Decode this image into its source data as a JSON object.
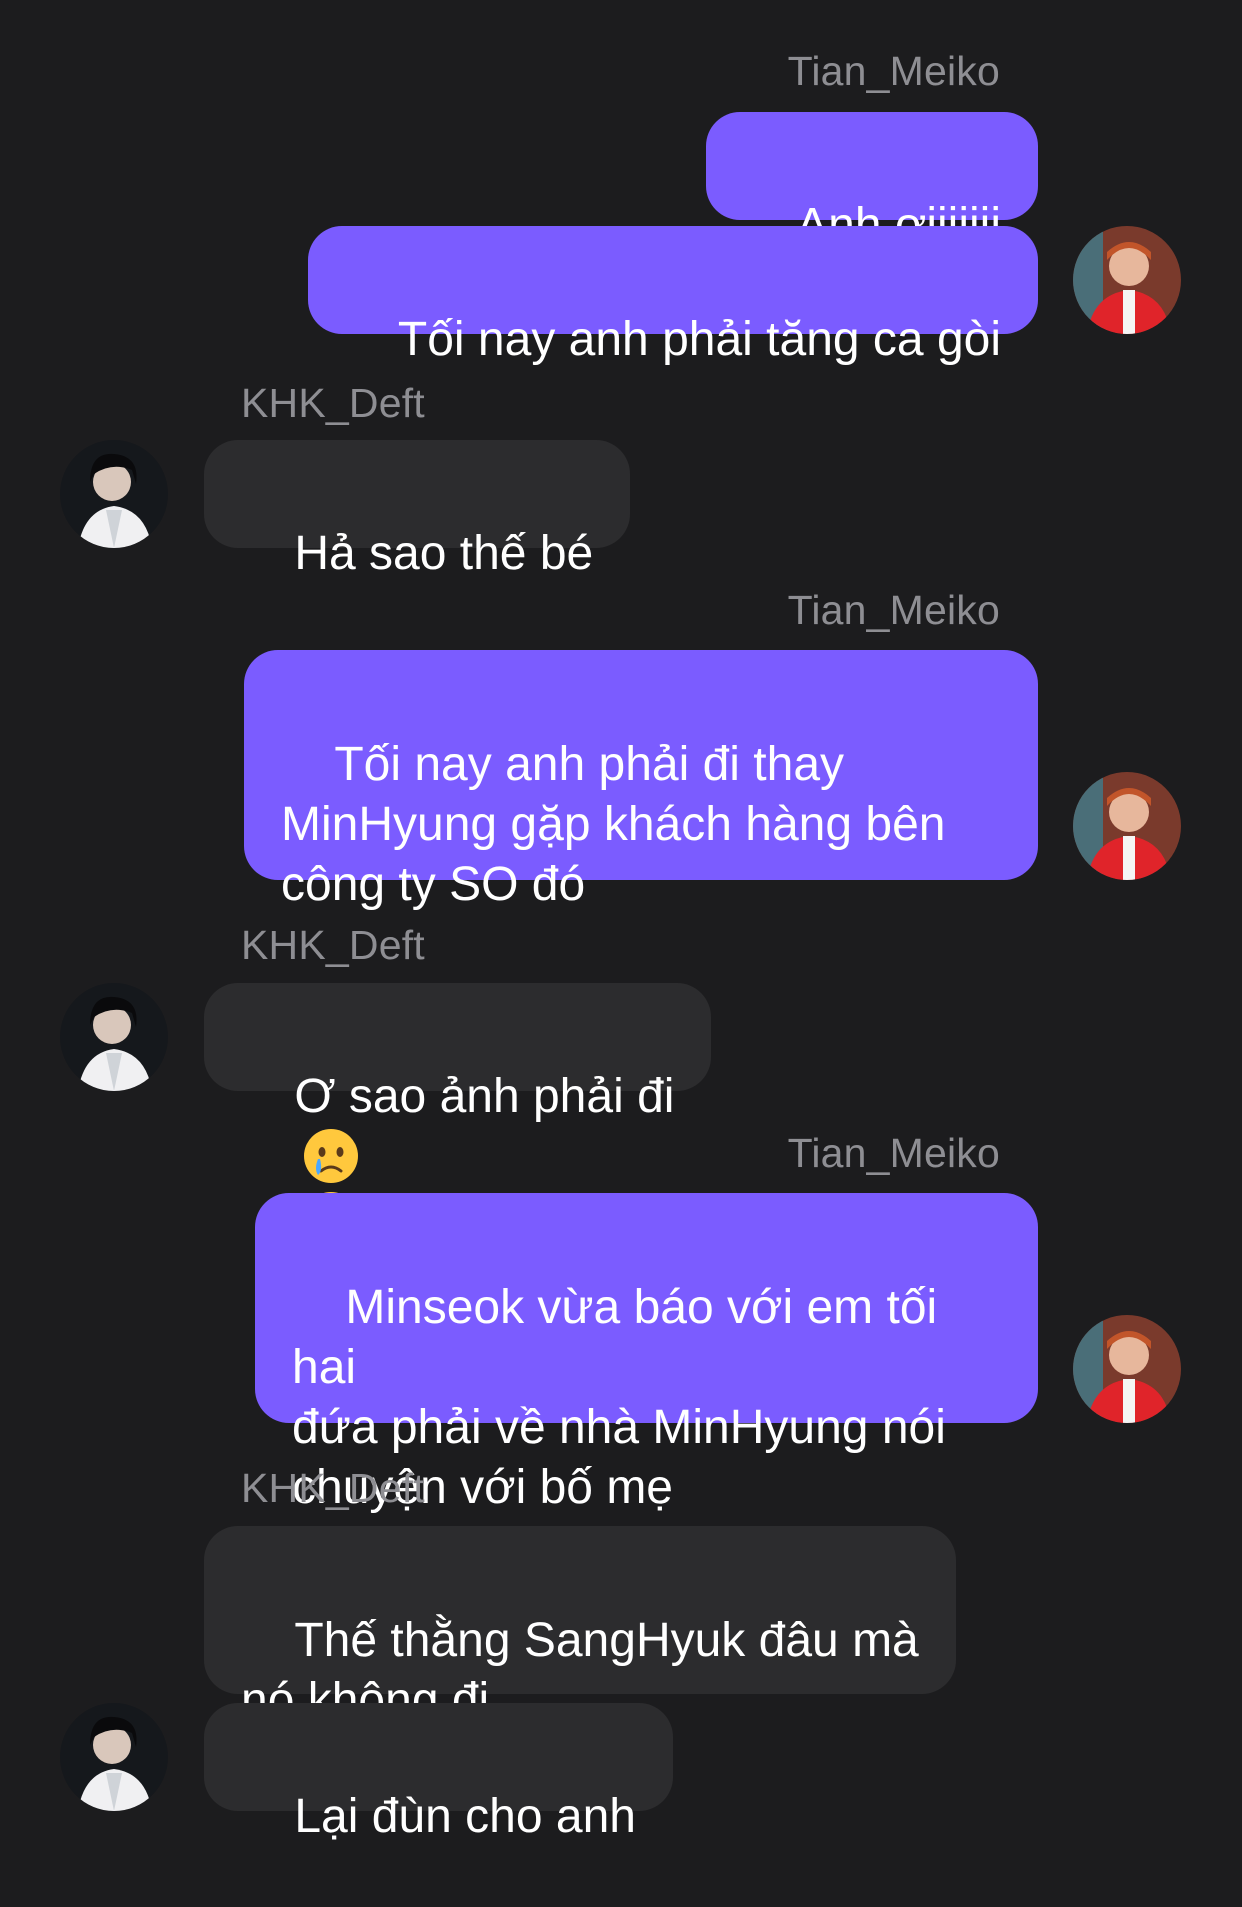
{
  "participants": {
    "me": "Tian_Meiko",
    "other": "KHK_Deft"
  },
  "colors": {
    "background": "#1c1c1e",
    "outgoing_bubble": "#7b5cff",
    "incoming_bubble": "#2c2c2e",
    "sender_name": "#8e8e93",
    "text": "#ffffff"
  },
  "messages": [
    {
      "group": 1,
      "sender": "Tian_Meiko",
      "text": "Anh ơiiiiiii"
    },
    {
      "group": 1,
      "sender": "Tian_Meiko",
      "text": "Tối nay anh phải tăng ca gòi"
    },
    {
      "group": 2,
      "sender": "KHK_Deft",
      "text": "Hả sao thế bé"
    },
    {
      "group": 3,
      "sender": "Tian_Meiko",
      "text": "Tối nay anh phải đi thay\nMinHyung gặp khách hàng bên\ncông ty SO đó"
    },
    {
      "group": 4,
      "sender": "KHK_Deft",
      "text": "Ơ sao ảnh phải đi",
      "emoji": [
        "crying-face-icon",
        "crying-face-icon"
      ]
    },
    {
      "group": 5,
      "sender": "Tian_Meiko",
      "text": "Minseok vừa báo với em tối hai\nđứa phải về nhà MinHyung nói\nchuyện với bố mẹ"
    },
    {
      "group": 6,
      "sender": "KHK_Deft",
      "text": "Thế thằng SangHyuk đâu mà\nnó không đi"
    },
    {
      "group": 6,
      "sender": "KHK_Deft",
      "text": "Lại đùn cho anh"
    }
  ]
}
